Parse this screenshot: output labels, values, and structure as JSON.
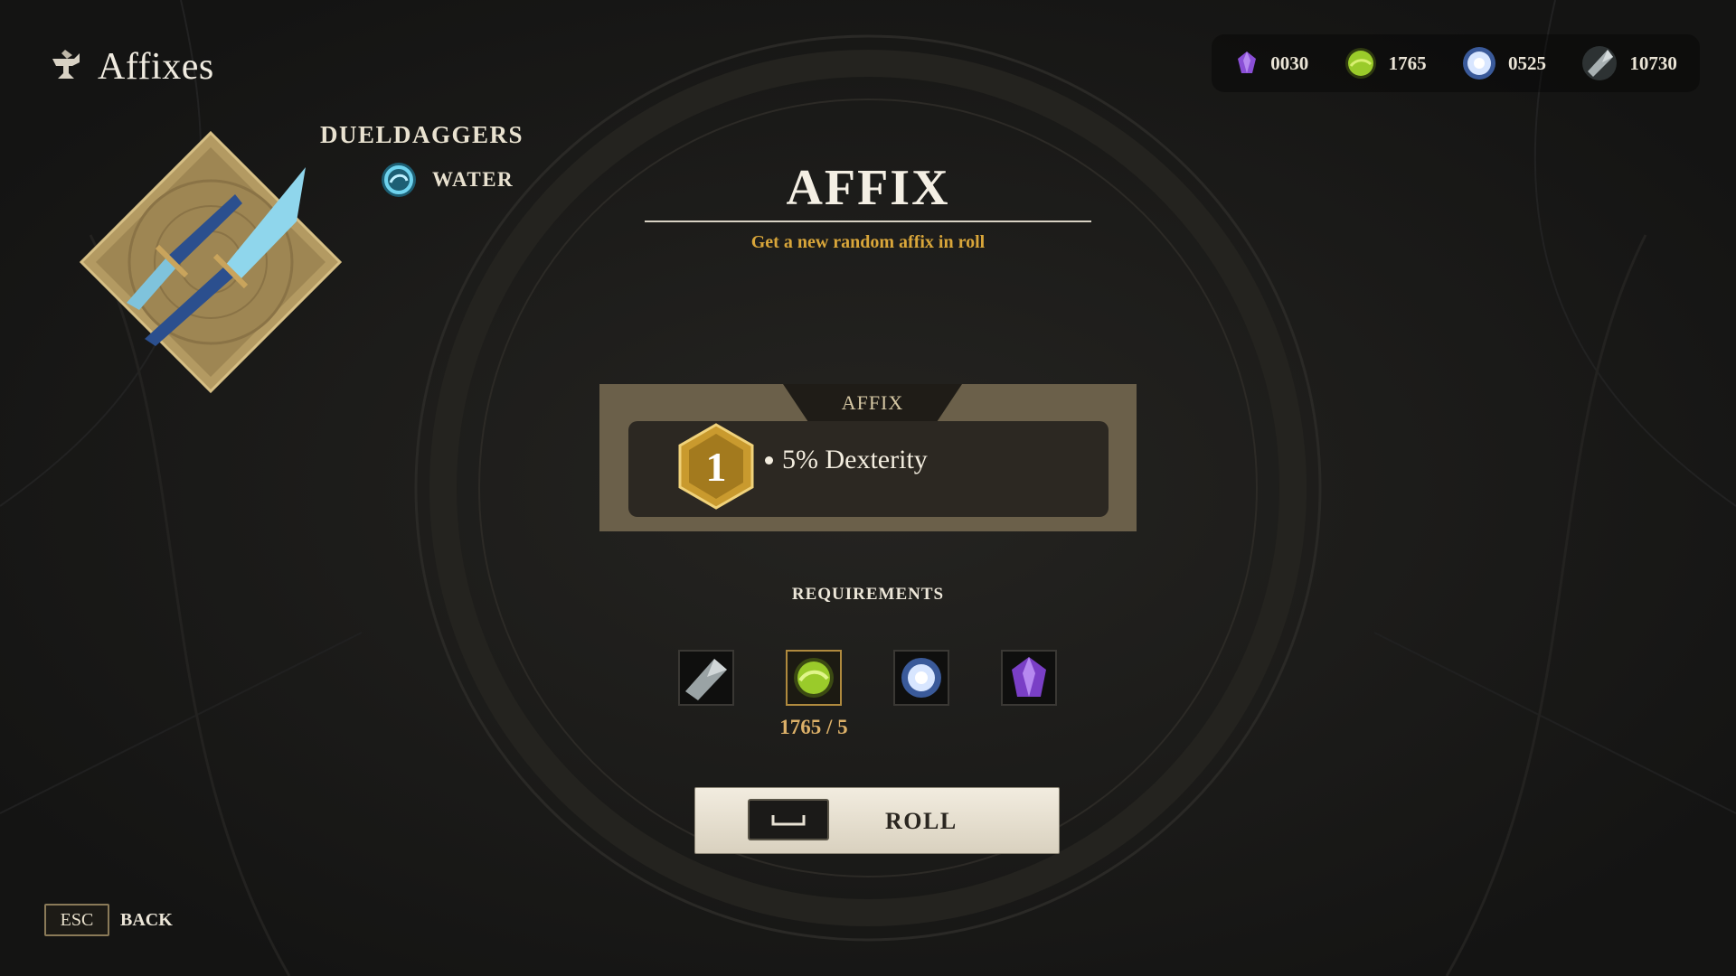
{
  "header": {
    "title": "Affixes",
    "icon": "anvil-icon"
  },
  "currencies": [
    {
      "name": "purple-crystal",
      "icon": "purple-crystal-icon",
      "value": "0030",
      "color": "#8a4fd6"
    },
    {
      "name": "green-orb",
      "icon": "green-orb-icon",
      "value": "1765",
      "color": "#9acb2a"
    },
    {
      "name": "white-essence",
      "icon": "white-essence-icon",
      "value": "0525",
      "color": "#d8e6ff"
    },
    {
      "name": "steel-shard",
      "icon": "steel-shard-icon",
      "value": "10730",
      "color": "#a8b0b2"
    }
  ],
  "weapon": {
    "name": "DUELDAGGERS",
    "element": "WATER",
    "icon": "dual-daggers-icon",
    "element_icon": "water-swirl-icon"
  },
  "panel": {
    "title": "AFFIX",
    "subtitle": "Get a new random affix in roll"
  },
  "affix": {
    "tab_label": "AFFIX",
    "level": "1",
    "text": "5% Dexterity"
  },
  "requirements": {
    "title": "REQUIREMENTS",
    "slots": [
      {
        "icon": "steel-shard-icon",
        "active": false
      },
      {
        "icon": "green-orb-icon",
        "active": true
      },
      {
        "icon": "white-essence-icon",
        "active": false
      },
      {
        "icon": "purple-crystal-icon",
        "active": false
      }
    ],
    "count": "1765 / 5"
  },
  "roll_button": {
    "label": "ROLL",
    "key_icon": "spacebar-key-icon"
  },
  "back": {
    "key": "ESC",
    "label": "BACK"
  },
  "colors": {
    "gold": "#d9a63a",
    "panel": "#6b604a",
    "background": "#1a1a18"
  }
}
